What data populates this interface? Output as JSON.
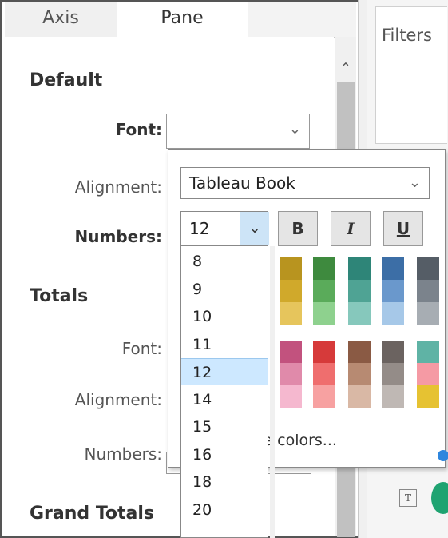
{
  "tabs": [
    {
      "label": "Axis"
    },
    {
      "label": "Pane"
    }
  ],
  "filters": {
    "label": "Filters"
  },
  "sections": {
    "default": {
      "title": "Default",
      "font_label": "Font:",
      "alignment_label": "Alignment:",
      "numbers_label": "Numbers:"
    },
    "totals": {
      "title": "Totals",
      "font_label": "Font:",
      "alignment_label": "Alignment:",
      "numbers_label": "Numbers:"
    },
    "grand_totals": {
      "title": "Grand Totals"
    }
  },
  "font_popup": {
    "font_family": "Tableau Book",
    "font_size": "12",
    "bold": "B",
    "italic": "I",
    "underline": "U",
    "more_colors": "re colors...",
    "size_options": [
      "8",
      "9",
      "10",
      "11",
      "12",
      "14",
      "15",
      "16",
      "18",
      "20"
    ],
    "selected_size": "12",
    "color_palette": [
      [
        "#b8941f",
        "#d0a92b",
        "#e6c55c"
      ],
      [
        "#3e8a3e",
        "#5aab5a",
        "#8ed18e"
      ],
      [
        "#2e8578",
        "#4fa394",
        "#86c8bc"
      ],
      [
        "#3c6ea6",
        "#6a98cc",
        "#a6c8e8"
      ],
      [
        "#555d66",
        "#7b838c",
        "#a7adb3"
      ],
      [
        "#c2527e",
        "#e08aaa",
        "#f5b8cf"
      ],
      [
        "#d63a3a",
        "#ef6e6e",
        "#f7a1a1"
      ],
      [
        "#8a5a44",
        "#b78a72",
        "#d9b8a5"
      ],
      [
        "#6b6360",
        "#948c88",
        "#bfb8b4"
      ],
      [
        "#5fb3a5",
        "#f59aa4",
        "#e6c232"
      ]
    ]
  }
}
